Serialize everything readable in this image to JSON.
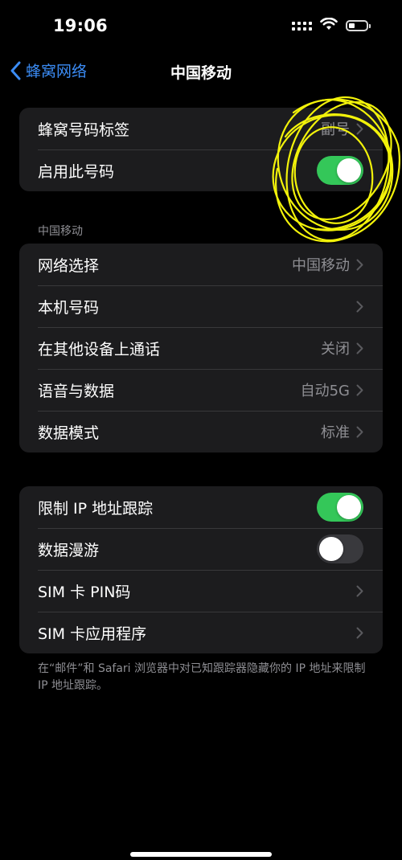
{
  "status_bar": {
    "time": "19:06",
    "icons": [
      "cellular-signal-icon",
      "wifi-icon",
      "battery-icon"
    ]
  },
  "nav": {
    "back_label": "蜂窝网络",
    "title": "中国移动"
  },
  "group1": {
    "rows": [
      {
        "label": "蜂窝号码标签",
        "value": "副号"
      },
      {
        "label": "启用此号码",
        "toggle": true
      }
    ]
  },
  "section_header": "中国移动",
  "group2": {
    "rows": [
      {
        "label": "网络选择",
        "value": "中国移动"
      },
      {
        "label": "本机号码",
        "value": ""
      },
      {
        "label": "在其他设备上通话",
        "value": "关闭"
      },
      {
        "label": "语音与数据",
        "value": "自动5G"
      },
      {
        "label": "数据模式",
        "value": "标准"
      }
    ]
  },
  "group3": {
    "rows": [
      {
        "label": "限制 IP 地址跟踪",
        "toggle": true
      },
      {
        "label": "数据漫游",
        "toggle": false
      },
      {
        "label": "SIM 卡 PIN码"
      },
      {
        "label": "SIM 卡应用程序"
      }
    ]
  },
  "footer_note": "在“邮件”和 Safari 浏览器中对已知跟踪器隐藏你的 IP 地址来限制 IP 地址跟踪。",
  "colors": {
    "accent": "#3b8cf5",
    "toggle_on": "#34c759",
    "toggle_off": "#39393d",
    "cell_bg": "#1c1c1e",
    "secondary_text": "#8e8e93",
    "annotation": "#f2f20a"
  }
}
